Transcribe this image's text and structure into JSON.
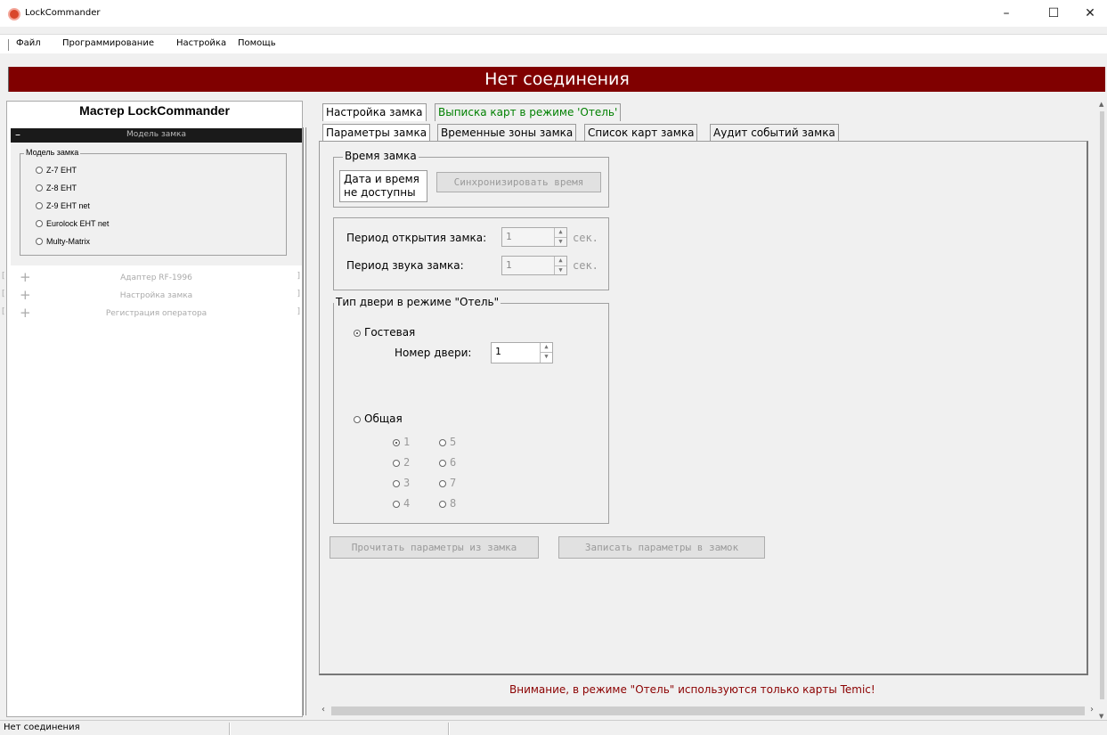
{
  "window": {
    "title": "LockCommander",
    "minimize": "–",
    "maximize": "☐",
    "close": "✕"
  },
  "menu": [
    "Файл",
    "Программирование",
    "Настройка",
    "Помощь"
  ],
  "banner": "Нет соединения",
  "left": {
    "title": "Мастер LockCommander",
    "section_title": "Модель замка",
    "section_minus": "–",
    "group_legend": "Модель замка",
    "models": [
      "Z-7 EHT",
      "Z-8 EHT",
      "Z-9 EHT net",
      "Eurolock EHT net",
      "Multy-Matrix"
    ],
    "collapsed": [
      "Адаптер RF-1996",
      "Настройка замка",
      "Регистрация оператора"
    ]
  },
  "tabs_top": [
    "Настройка замка",
    "Выписка карт в режиме 'Отель'"
  ],
  "tabs_sub": [
    "Параметры замка",
    "Временные зоны замка",
    "Список карт замка",
    "Аудит событий замка"
  ],
  "time_group": {
    "legend": "Время замка",
    "status_line1": "Дата и время",
    "status_line2": "не доступны",
    "sync_button": "Синхронизировать время"
  },
  "periods": {
    "open_label": "Период открытия замка:",
    "open_value": "1",
    "open_unit": "сек.",
    "sound_label": "Период звука замка:",
    "sound_value": "1",
    "sound_unit": "сек."
  },
  "door_group": {
    "legend": "Тип двери в режиме \"Отель\"",
    "guest_label": "Гостевая",
    "door_number_label": "Номер двери:",
    "door_number_value": "1",
    "common_label": "Общая",
    "common_options": [
      "1",
      "2",
      "3",
      "4",
      "5",
      "6",
      "7",
      "8"
    ],
    "common_selected": "1"
  },
  "buttons": {
    "read": "Прочитать параметры из замка",
    "write": "Записать параметры в замок"
  },
  "warning": "Внимание, в режиме \"Отель\" используются только карты Temic!",
  "status": {
    "connection": "Нет соединения"
  },
  "colors": {
    "banner_bg": "#800000",
    "active_tab_text": "#008000",
    "warning_text": "#8b0000"
  }
}
